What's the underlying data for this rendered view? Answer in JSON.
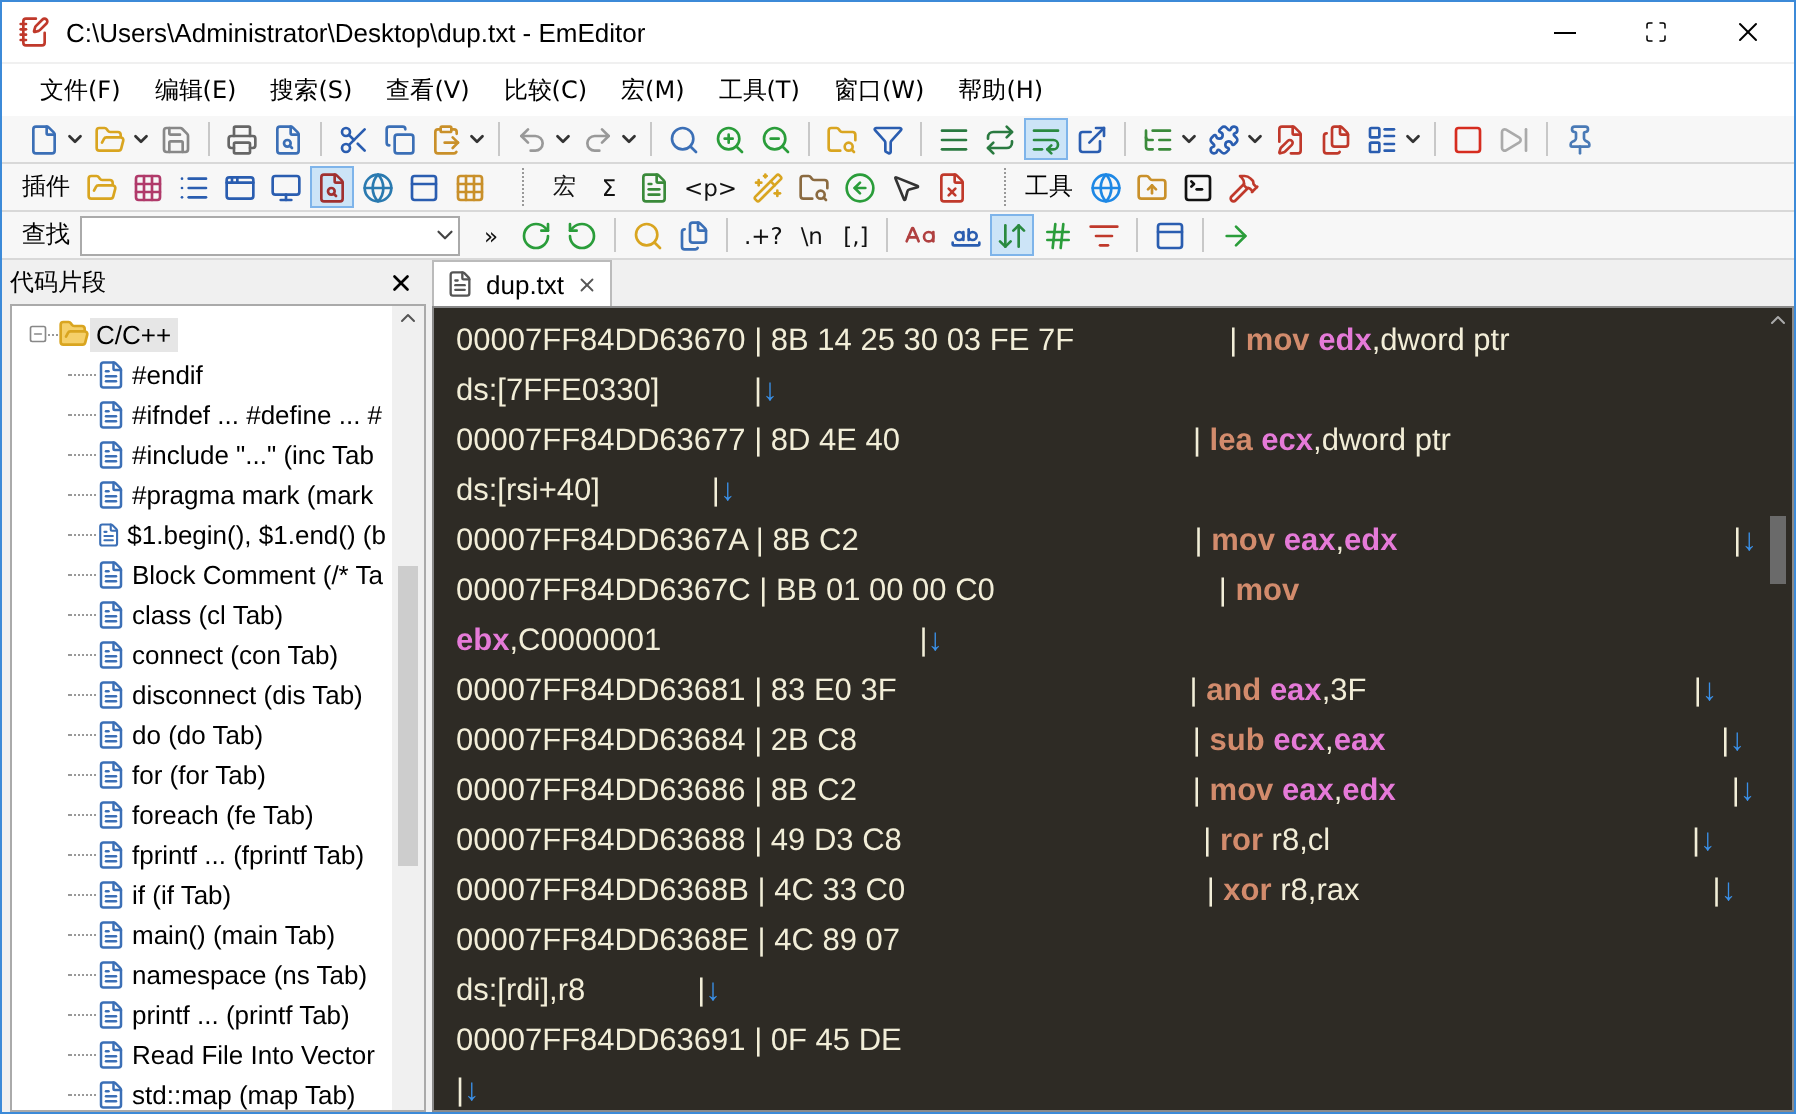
{
  "window": {
    "title": "C:\\Users\\Administrator\\Desktop\\dup.txt - EmEditor"
  },
  "menu": [
    "文件(F)",
    "编辑(E)",
    "搜索(S)",
    "查看(V)",
    "比较(C)",
    "宏(M)",
    "工具(T)",
    "窗口(W)",
    "帮助(H)"
  ],
  "toolbars": [
    {
      "items": [
        {
          "kind": "icon",
          "pressed": false
        },
        {
          "kind": "dropdown"
        },
        {
          "kind": "icon",
          "pressed": false
        },
        {
          "kind": "dropdown"
        },
        {
          "kind": "icon",
          "pressed": false
        },
        {
          "kind": "separator"
        },
        {
          "kind": "icon",
          "pressed": false
        },
        {
          "kind": "icon",
          "pressed": false
        },
        {
          "kind": "separator"
        },
        {
          "kind": "icon",
          "pressed": false
        },
        {
          "kind": "icon",
          "pressed": false
        },
        {
          "kind": "icon",
          "pressed": false
        },
        {
          "kind": "dropdown"
        },
        {
          "kind": "separator"
        },
        {
          "kind": "icon",
          "pressed": false
        },
        {
          "kind": "dropdown"
        },
        {
          "kind": "icon",
          "pressed": false
        },
        {
          "kind": "dropdown"
        },
        {
          "kind": "separator"
        },
        {
          "kind": "icon",
          "pressed": false
        },
        {
          "kind": "icon",
          "pressed": false
        },
        {
          "kind": "icon",
          "pressed": false
        },
        {
          "kind": "separator"
        },
        {
          "kind": "icon",
          "pressed": false
        },
        {
          "kind": "icon",
          "pressed": false
        },
        {
          "kind": "separator"
        },
        {
          "kind": "icon",
          "pressed": false
        },
        {
          "kind": "icon",
          "pressed": false
        },
        {
          "kind": "icon",
          "pressed": true
        },
        {
          "kind": "icon",
          "pressed": false
        },
        {
          "kind": "separator"
        },
        {
          "kind": "icon",
          "pressed": false
        },
        {
          "kind": "dropdown"
        },
        {
          "kind": "icon",
          "pressed": false
        },
        {
          "kind": "dropdown"
        },
        {
          "kind": "icon",
          "pressed": false
        },
        {
          "kind": "icon",
          "pressed": false
        },
        {
          "kind": "icon",
          "pressed": false
        },
        {
          "kind": "dropdown"
        },
        {
          "kind": "separator"
        },
        {
          "kind": "icon",
          "pressed": false
        },
        {
          "kind": "icon",
          "pressed": false
        },
        {
          "kind": "separator"
        },
        {
          "kind": "icon",
          "pressed": false
        }
      ]
    },
    {
      "items": [
        {
          "kind": "label",
          "text": "插件"
        },
        {
          "kind": "icon",
          "pressed": false
        },
        {
          "kind": "icon",
          "pressed": false
        },
        {
          "kind": "icon",
          "pressed": false
        },
        {
          "kind": "icon",
          "pressed": false
        },
        {
          "kind": "icon",
          "pressed": false
        },
        {
          "kind": "icon",
          "pressed": true
        },
        {
          "kind": "icon",
          "pressed": false
        },
        {
          "kind": "icon",
          "pressed": false
        },
        {
          "kind": "icon",
          "pressed": false
        },
        {
          "kind": "grip"
        },
        {
          "kind": "text",
          "text": "宏"
        },
        {
          "kind": "text",
          "text": "Σ"
        },
        {
          "kind": "icon",
          "pressed": false
        },
        {
          "kind": "text",
          "text": "<p>"
        },
        {
          "kind": "icon",
          "pressed": false
        },
        {
          "kind": "icon",
          "pressed": false
        },
        {
          "kind": "icon",
          "pressed": false
        },
        {
          "kind": "icon",
          "pressed": false
        },
        {
          "kind": "icon",
          "pressed": false
        },
        {
          "kind": "grip"
        },
        {
          "kind": "label",
          "text": "工具"
        },
        {
          "kind": "icon",
          "pressed": false
        },
        {
          "kind": "icon",
          "pressed": false
        },
        {
          "kind": "icon",
          "pressed": false
        },
        {
          "kind": "icon",
          "pressed": false
        }
      ]
    },
    {
      "items": [
        {
          "kind": "label",
          "text": "查找"
        },
        {
          "kind": "combo"
        },
        {
          "kind": "text",
          "text": "»"
        },
        {
          "kind": "icon",
          "pressed": false
        },
        {
          "kind": "icon",
          "pressed": false
        },
        {
          "kind": "separator"
        },
        {
          "kind": "icon",
          "pressed": false
        },
        {
          "kind": "icon",
          "pressed": false
        },
        {
          "kind": "separator"
        },
        {
          "kind": "text",
          "text": ".+?"
        },
        {
          "kind": "text",
          "text": "\\n"
        },
        {
          "kind": "text",
          "text": "[,]"
        },
        {
          "kind": "separator"
        },
        {
          "kind": "icon",
          "pressed": false
        },
        {
          "kind": "icon",
          "pressed": false
        },
        {
          "kind": "icon",
          "pressed": true
        },
        {
          "kind": "icon",
          "pressed": false
        },
        {
          "kind": "icon",
          "pressed": false
        },
        {
          "kind": "separator"
        },
        {
          "kind": "icon",
          "pressed": false
        },
        {
          "kind": "separator"
        },
        {
          "kind": "icon",
          "pressed": false
        }
      ]
    }
  ],
  "sidebar": {
    "title": "代码片段",
    "tree": [
      {
        "label": "C/C++",
        "expanded": true,
        "selected": true,
        "children": [
          {
            "label": "#endif"
          },
          {
            "label": "#ifndef ... #define ... #"
          },
          {
            "label": "#include \"...\"  (inc Tab"
          },
          {
            "label": "#pragma mark  (mark"
          },
          {
            "label": "$1.begin(), $1.end()  (b"
          },
          {
            "label": "Block Comment  (/* Ta"
          },
          {
            "label": "class  (cl Tab)"
          },
          {
            "label": "connect  (con Tab)"
          },
          {
            "label": "disconnect  (dis Tab)"
          },
          {
            "label": "do  (do Tab)"
          },
          {
            "label": "for  (for Tab)"
          },
          {
            "label": "foreach  (fe Tab)"
          },
          {
            "label": "fprintf ...  (fprintf Tab)"
          },
          {
            "label": "if  (if Tab)"
          },
          {
            "label": "main()  (main Tab)"
          },
          {
            "label": "namespace  (ns Tab)"
          },
          {
            "label": "printf ...  (printf Tab)"
          },
          {
            "label": "Read File Into Vector"
          },
          {
            "label": "std::map  (map Tab)"
          }
        ]
      }
    ]
  },
  "tabs": [
    {
      "label": "dup.txt",
      "selected": true
    }
  ],
  "editor": {
    "lines": [
      [
        {
          "kind": "plain",
          "text": "00007FF84DD63670 | 8B 14 25 30 03 FE 7F                  | "
        },
        {
          "kind": "mnemonic",
          "text": "mov "
        },
        {
          "kind": "register",
          "text": "edx"
        },
        {
          "kind": "plain",
          "text": ",dword ptr"
        }
      ],
      [
        {
          "kind": "plain",
          "text": "ds:[7FFE0330]           |"
        },
        {
          "kind": "eol",
          "text": "↓"
        }
      ],
      [
        {
          "kind": "plain",
          "text": "00007FF84DD63677 | 8D 4E 40                                  | "
        },
        {
          "kind": "mnemonic",
          "text": "lea "
        },
        {
          "kind": "register",
          "text": "ecx"
        },
        {
          "kind": "plain",
          "text": ",dword ptr"
        }
      ],
      [
        {
          "kind": "plain",
          "text": "ds:[rsi+40]             |"
        },
        {
          "kind": "eol",
          "text": "↓"
        }
      ],
      [
        {
          "kind": "plain",
          "text": "00007FF84DD6367A | 8B C2                                       | "
        },
        {
          "kind": "mnemonic",
          "text": "mov "
        },
        {
          "kind": "register",
          "text": "eax"
        },
        {
          "kind": "plain",
          "text": ","
        },
        {
          "kind": "register",
          "text": "edx"
        },
        {
          "kind": "plain",
          "text": "                                       |"
        },
        {
          "kind": "eol",
          "text": "↓"
        }
      ],
      [
        {
          "kind": "plain",
          "text": "00007FF84DD6367C | BB 01 00 00 C0                          | "
        },
        {
          "kind": "mnemonic",
          "text": "mov"
        }
      ],
      [
        {
          "kind": "register",
          "text": "ebx"
        },
        {
          "kind": "plain",
          "text": ",C0000001                              |"
        },
        {
          "kind": "eol",
          "text": "↓"
        }
      ],
      [
        {
          "kind": "plain",
          "text": "00007FF84DD63681 | 83 E0 3F                                  | "
        },
        {
          "kind": "mnemonic",
          "text": "and "
        },
        {
          "kind": "register",
          "text": "eax"
        },
        {
          "kind": "plain",
          "text": ",3F                                      |"
        },
        {
          "kind": "eol",
          "text": "↓"
        }
      ],
      [
        {
          "kind": "plain",
          "text": "00007FF84DD63684 | 2B C8                                       | "
        },
        {
          "kind": "mnemonic",
          "text": "sub "
        },
        {
          "kind": "register",
          "text": "ecx"
        },
        {
          "kind": "plain",
          "text": ","
        },
        {
          "kind": "register",
          "text": "eax"
        },
        {
          "kind": "plain",
          "text": "                                       |"
        },
        {
          "kind": "eol",
          "text": "↓"
        }
      ],
      [
        {
          "kind": "plain",
          "text": "00007FF84DD63686 | 8B C2                                       | "
        },
        {
          "kind": "mnemonic",
          "text": "mov "
        },
        {
          "kind": "register",
          "text": "eax"
        },
        {
          "kind": "plain",
          "text": ","
        },
        {
          "kind": "register",
          "text": "edx"
        },
        {
          "kind": "plain",
          "text": "                                       |"
        },
        {
          "kind": "eol",
          "text": "↓"
        }
      ],
      [
        {
          "kind": "plain",
          "text": "00007FF84DD63688 | 49 D3 C8                                   | "
        },
        {
          "kind": "mnemonic",
          "text": "ror"
        },
        {
          "kind": "plain",
          "text": " r8,cl                                          |"
        },
        {
          "kind": "eol",
          "text": "↓"
        }
      ],
      [
        {
          "kind": "plain",
          "text": "00007FF84DD6368B | 4C 33 C0                                   | "
        },
        {
          "kind": "mnemonic",
          "text": "xor"
        },
        {
          "kind": "plain",
          "text": " r8,rax                                         |"
        },
        {
          "kind": "eol",
          "text": "↓"
        }
      ],
      [
        {
          "kind": "plain",
          "text": "00007FF84DD6368E | 4C 89 07"
        }
      ],
      [
        {
          "kind": "plain",
          "text": "ds:[rdi],r8             |"
        },
        {
          "kind": "eol",
          "text": "↓"
        }
      ],
      [
        {
          "kind": "plain",
          "text": "00007FF84DD63691 | 0F 45 DE"
        }
      ],
      [
        {
          "kind": "plain",
          "text": "|"
        },
        {
          "kind": "eol",
          "text": "↓"
        }
      ]
    ]
  }
}
